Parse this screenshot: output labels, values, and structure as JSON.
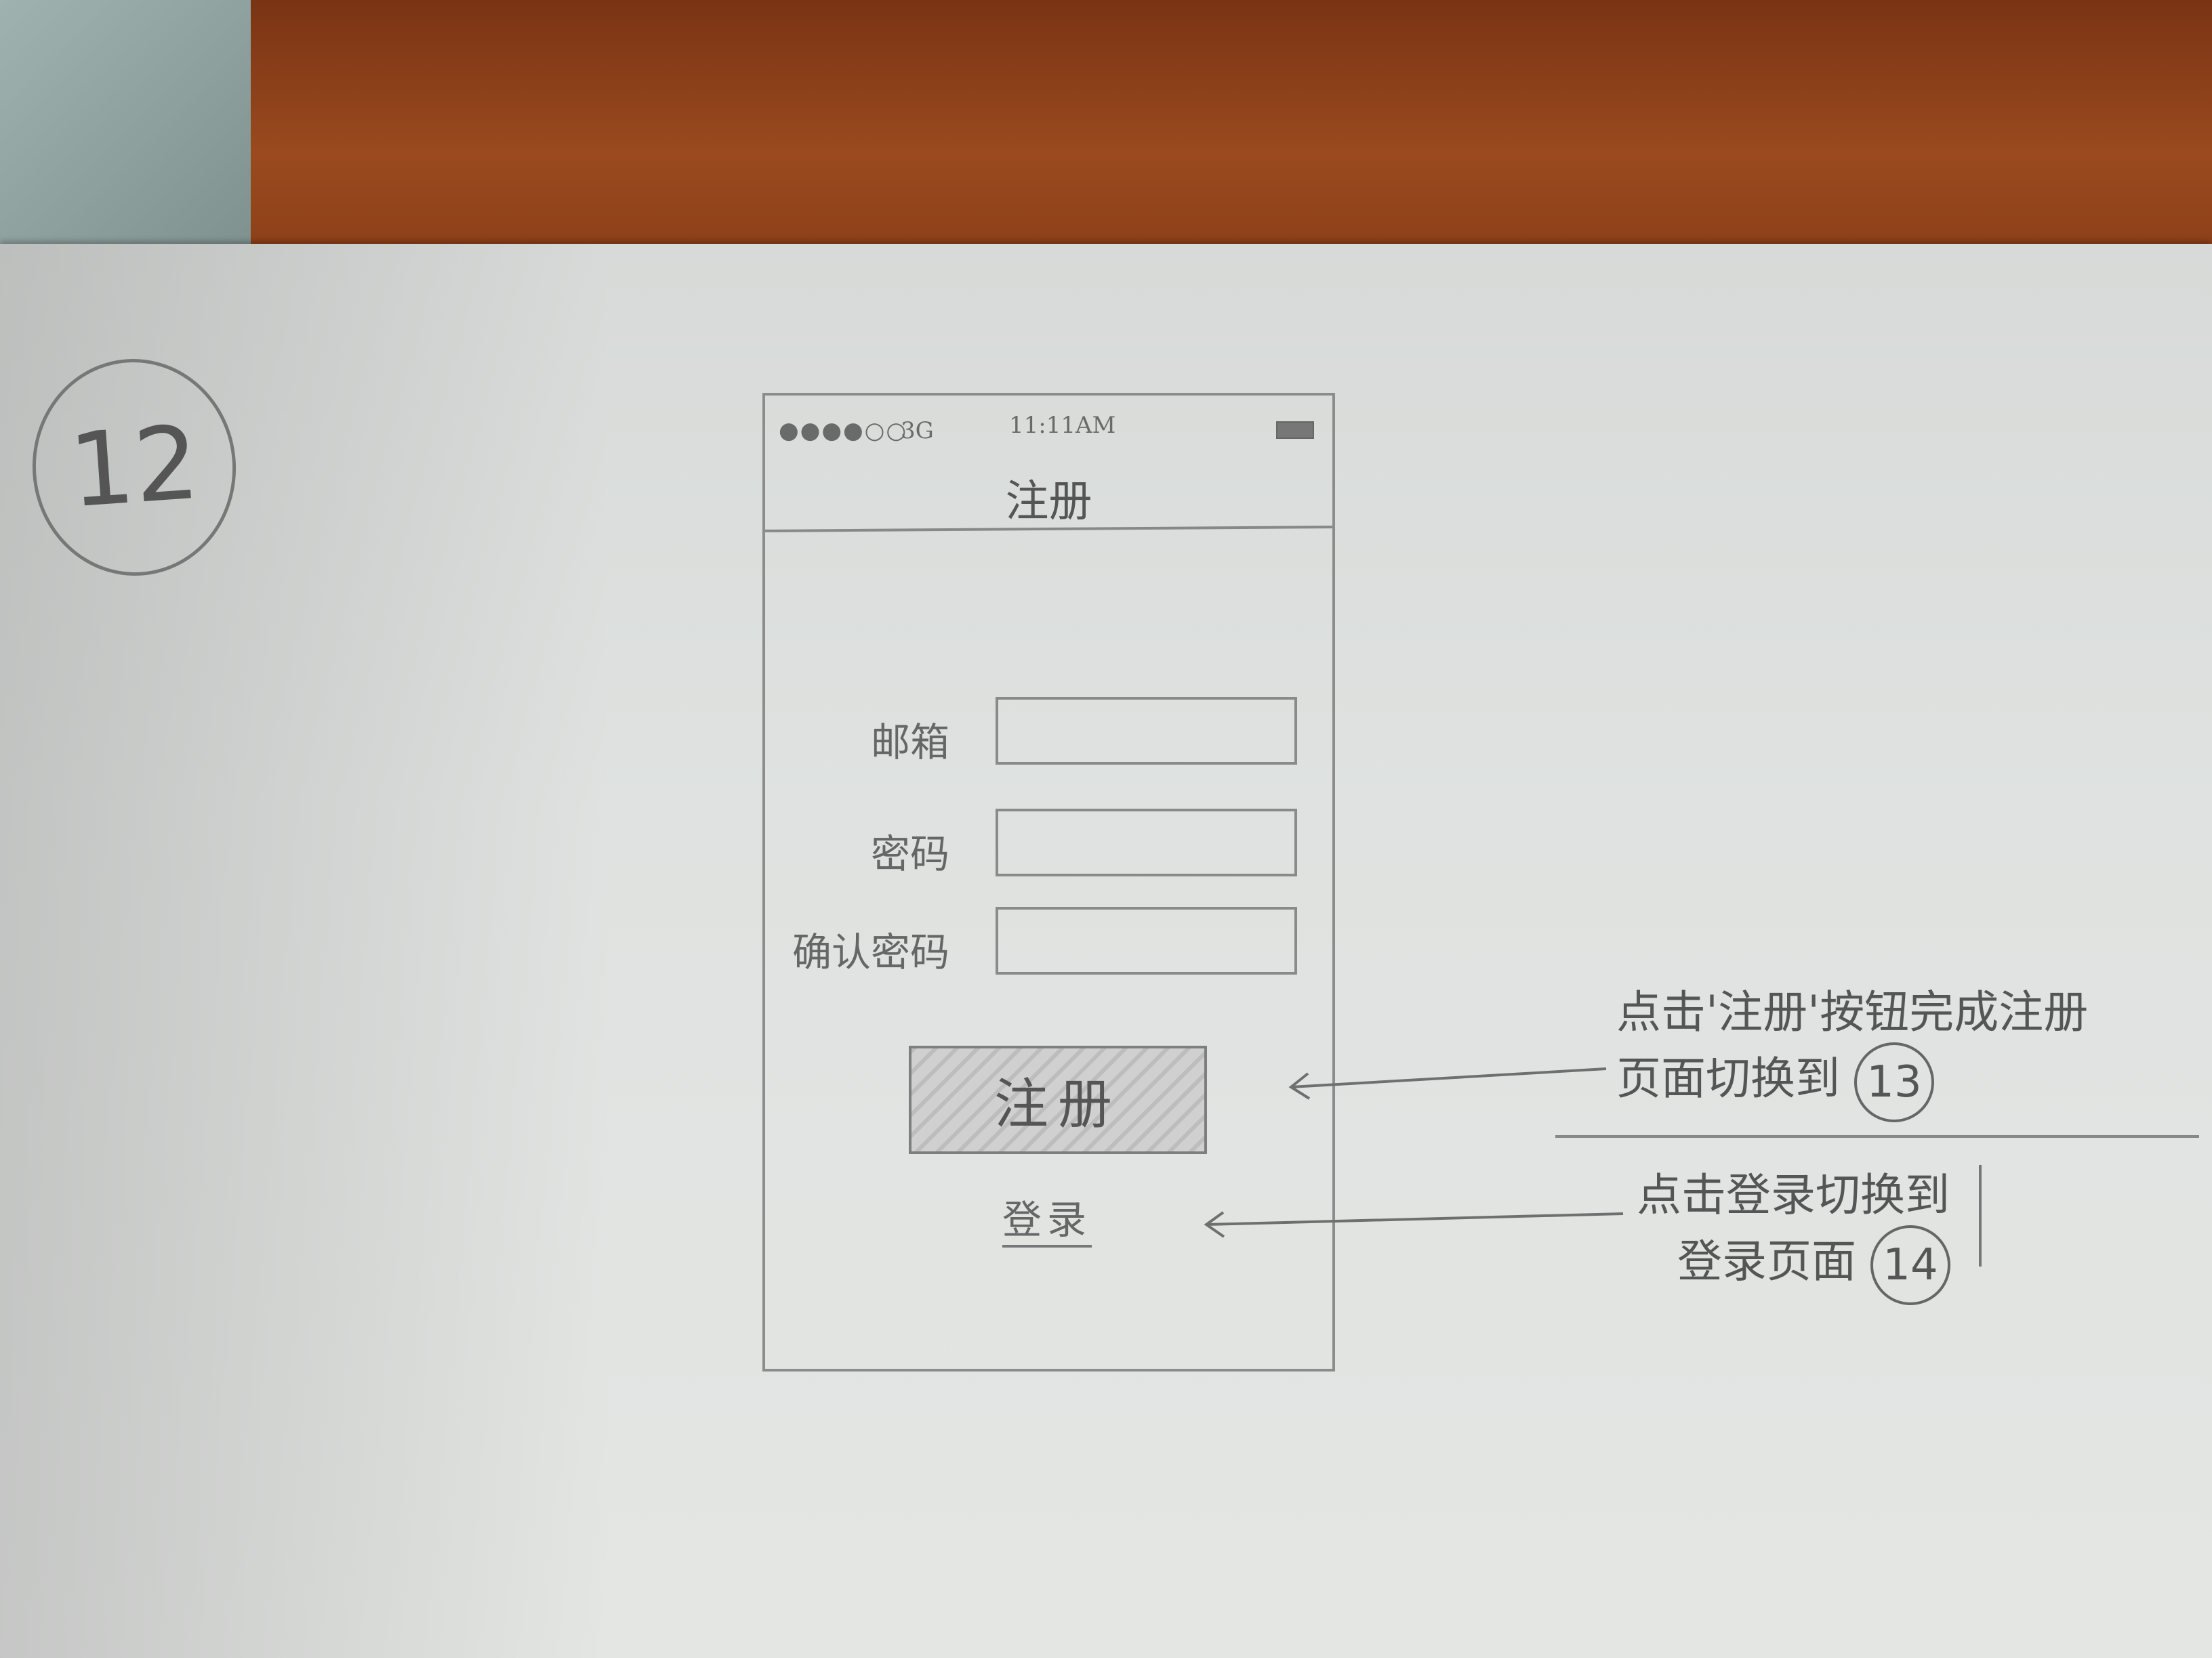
{
  "sketch": {
    "page_number": "12",
    "status_bar": {
      "signal": "●●●●○○",
      "carrier": "3G",
      "time": "11:11AM",
      "battery_icon": "battery-icon"
    },
    "screen": {
      "title": "注册",
      "form": {
        "email_label": "邮箱",
        "password_label": "密码",
        "confirm_password_label": "确认密码",
        "email_value": "",
        "password_value": "",
        "confirm_password_value": ""
      },
      "register_button": "注册",
      "login_link": "登录"
    },
    "annotations": {
      "register": {
        "line1": "点击'注册'按钮完成注册",
        "line2": "页面切换到",
        "target": "13"
      },
      "login": {
        "line1": "点击登录切换到",
        "line2": "登录页面",
        "target": "14"
      }
    }
  }
}
